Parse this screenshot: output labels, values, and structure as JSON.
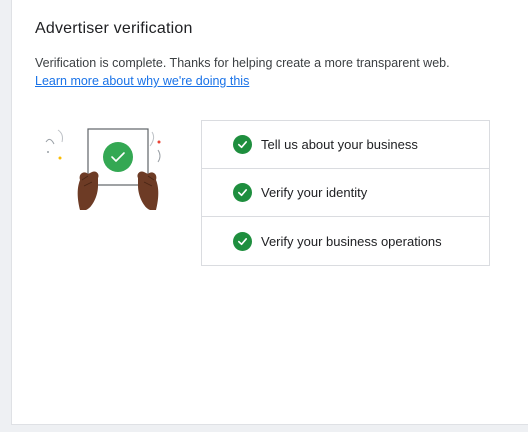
{
  "page": {
    "title": "Advertiser verification",
    "description": "Verification is complete. Thanks for helping create a more transparent web.",
    "learn_more_link": "Learn more about why we're doing this"
  },
  "steps": [
    {
      "label": "Tell us about your business",
      "status": "complete",
      "icon": "check-circle-icon"
    },
    {
      "label": "Verify your identity",
      "status": "complete",
      "icon": "check-circle-icon"
    },
    {
      "label": "Verify your business operations",
      "status": "complete",
      "icon": "check-circle-icon"
    }
  ],
  "colors": {
    "success_green": "#1e8e3e",
    "illustration_green": "#34a853",
    "link_blue": "#1a73e8",
    "hand_brown": "#6d3b25"
  }
}
